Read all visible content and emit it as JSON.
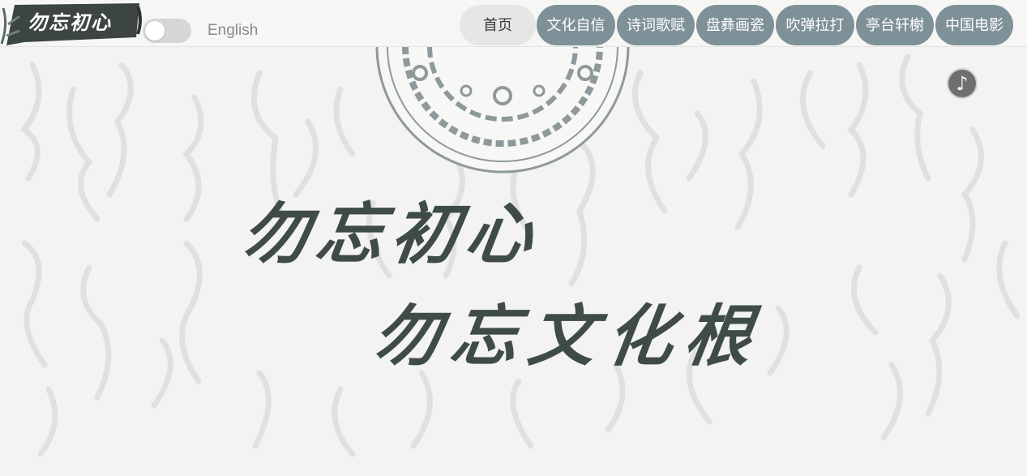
{
  "header": {
    "logo_text": "勿忘初心",
    "language_label": "English",
    "language_toggle_on": false
  },
  "nav": {
    "items": [
      {
        "label": "首页",
        "active": true
      },
      {
        "label": "文化自信",
        "active": false
      },
      {
        "label": "诗词歌赋",
        "active": false
      },
      {
        "label": "盘彝画瓷",
        "active": false
      },
      {
        "label": "吹弹拉打",
        "active": false
      },
      {
        "label": "亭台轩榭",
        "active": false
      },
      {
        "label": "中国电影",
        "active": false
      }
    ]
  },
  "hero": {
    "line1": "勿忘初心",
    "line2": "勿忘文化根"
  },
  "music": {
    "icon": "music-note-icon",
    "glyph": "♪"
  },
  "colors": {
    "nav_bg": "#7f9198",
    "nav_active_bg": "#e6e6e6",
    "slogan": "#3f4b48",
    "logo_bg": "#3c4543",
    "page_bg": "#f3f3f1"
  }
}
